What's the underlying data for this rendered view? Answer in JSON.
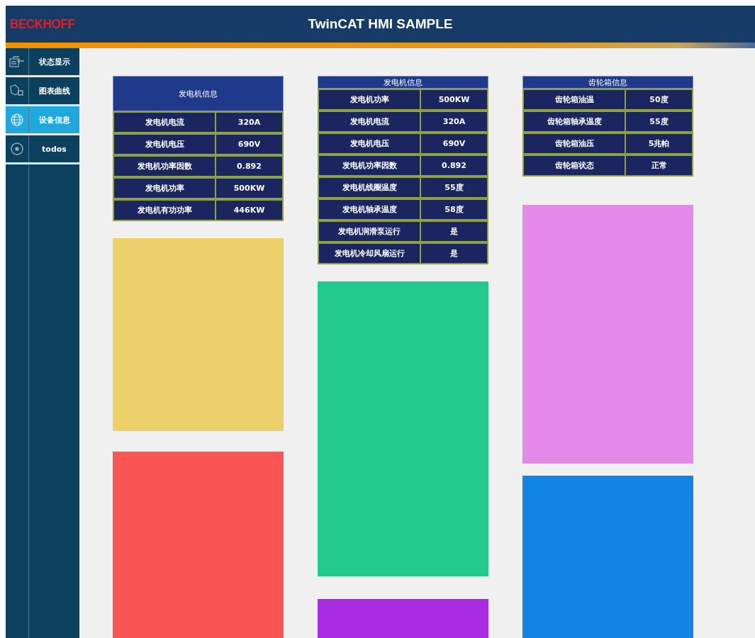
{
  "header": {
    "logo": "BECKHOFF",
    "title": "TwinCAT HMI SAMPLE"
  },
  "sidebar": {
    "items": [
      {
        "label": "状态显示",
        "selected": false
      },
      {
        "label": "图表曲线",
        "selected": false
      },
      {
        "label": "设备信息",
        "selected": true
      },
      {
        "label": "todos",
        "selected": false
      }
    ]
  },
  "columns": [
    {
      "table": {
        "title": "发电机信息",
        "rows": [
          {
            "label": "发电机电流",
            "value": "320A"
          },
          {
            "label": "发电机电压",
            "value": "690V"
          },
          {
            "label": "发电机功率因数",
            "value": "0.892"
          },
          {
            "label": "发电机功率",
            "value": "500KW"
          },
          {
            "label": "发电机有功功率",
            "value": "446KW"
          }
        ]
      },
      "blocks": [
        {
          "color": "#ecd16a"
        },
        {
          "color": "#f95555"
        }
      ]
    },
    {
      "table": {
        "title": "发电机信息",
        "rows": [
          {
            "label": "发电机功率",
            "value": "500KW"
          },
          {
            "label": "发电机电流",
            "value": "320A"
          },
          {
            "label": "发电机电压",
            "value": "690V"
          },
          {
            "label": "发电机功率因数",
            "value": "0.892"
          },
          {
            "label": "发电机线圈温度",
            "value": "55度"
          },
          {
            "label": "发电机轴承温度",
            "value": "58度"
          },
          {
            "label": "发电机润滑泵运行",
            "value": "是"
          },
          {
            "label": "发电机冷却风扇运行",
            "value": "是"
          }
        ]
      },
      "blocks": [
        {
          "color": "#23c98d"
        },
        {
          "color": "#a92ce2"
        }
      ]
    },
    {
      "table": {
        "title": "齿轮箱信息",
        "rows": [
          {
            "label": "齿轮箱油温",
            "value": "50度"
          },
          {
            "label": "齿轮箱轴承温度",
            "value": "55度"
          },
          {
            "label": "齿轮箱油压",
            "value": "5兆帕"
          },
          {
            "label": "齿轮箱状态",
            "value": "正常"
          }
        ]
      },
      "blocks": [
        {
          "color": "#e289ea"
        },
        {
          "color": "#1383e6"
        }
      ]
    }
  ]
}
